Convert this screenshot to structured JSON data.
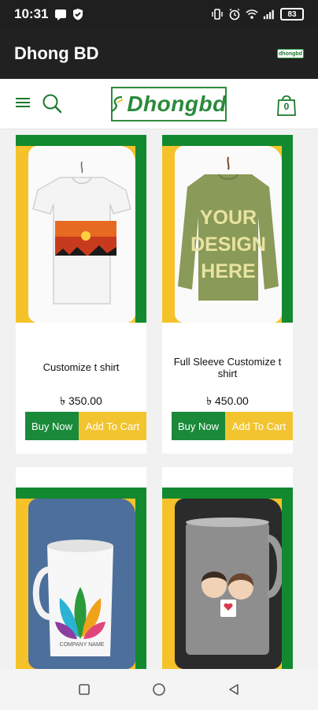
{
  "status_bar": {
    "time": "10:31",
    "battery": "83",
    "icons": [
      "message-icon",
      "shield-icon",
      "vibrate-icon",
      "alarm-icon",
      "wifi-icon",
      "signal-icon",
      "battery-icon"
    ]
  },
  "app_bar": {
    "title": "Dhong BD",
    "logo_text": "dhongbd"
  },
  "header": {
    "logo_text": "Dhongbd",
    "cart_count": "0",
    "icons": [
      "menu-icon",
      "search-icon",
      "shopping-bag-icon"
    ]
  },
  "products": [
    {
      "title": "Customize t shirt",
      "price": "৳ 350.00",
      "buy_label": "Buy Now",
      "cart_label": "Add To Cart"
    },
    {
      "title": "Full Sleeve Customize t shirt",
      "price": "৳ 450.00",
      "buy_label": "Buy Now",
      "cart_label": "Add To Cart",
      "image_text": [
        "YOUR",
        "DESIGN",
        "HERE"
      ]
    },
    {
      "image_text": [
        "COMPANY NAME"
      ]
    },
    {}
  ],
  "nav_bar": {
    "icons": [
      "recent-apps-icon",
      "home-icon",
      "back-icon"
    ]
  },
  "colors": {
    "brand_green": "#1a8a3a",
    "brand_yellow": "#f2c530",
    "app_bar": "#212121"
  }
}
